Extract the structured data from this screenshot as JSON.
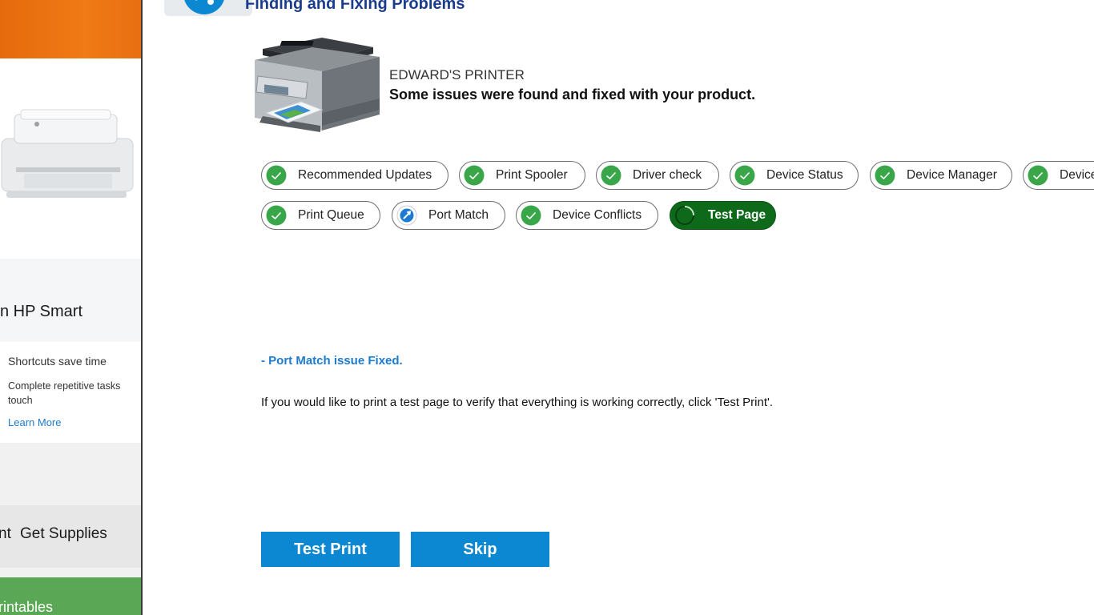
{
  "window": {
    "title": "Finding and Fixing Problems"
  },
  "background_app": {
    "hp_smart_title": "n HP Smart",
    "shortcut_title": "Shortcuts save time",
    "shortcut_desc": "Complete repetitive tasks touch",
    "learn_more": "Learn More",
    "supplies_prev": "nt",
    "get_supplies": "Get Supplies",
    "printables": "rintables",
    "banner_color": "#f07a15",
    "printables_color": "#5aa855"
  },
  "device": {
    "name": "EDWARD'S PRINTER",
    "status": "Some issues were found and fixed with your product."
  },
  "checks": [
    {
      "label": "Recommended Updates",
      "status": "passed",
      "icon": "check-circle-icon"
    },
    {
      "label": "Print Spooler",
      "status": "passed",
      "icon": "check-circle-icon"
    },
    {
      "label": "Driver check",
      "status": "passed",
      "icon": "check-circle-icon"
    },
    {
      "label": "Device Status",
      "status": "passed",
      "icon": "check-circle-icon"
    },
    {
      "label": "Device Manager",
      "status": "passed",
      "icon": "check-circle-icon"
    },
    {
      "label": "Device",
      "status": "passed",
      "icon": "check-circle-icon"
    },
    {
      "label": "Print Queue",
      "status": "passed",
      "icon": "check-circle-icon"
    },
    {
      "label": "Port Match",
      "status": "fixed",
      "icon": "wrench-icon"
    },
    {
      "label": "Device Conflicts",
      "status": "passed",
      "icon": "check-circle-icon"
    },
    {
      "label": "Test Page",
      "status": "in-progress",
      "icon": "spinner-icon"
    }
  ],
  "messages": {
    "fixed": "- Port Match issue Fixed.",
    "info": "If you would like to print a test page to verify that everything is working correctly, click 'Test Print'."
  },
  "buttons": {
    "test_print": "Test Print",
    "skip": "Skip"
  },
  "colors": {
    "accent": "#0c87d2",
    "success": "#3aa64a",
    "active_pill": "#0e6a1a",
    "link": "#1c7ad0"
  }
}
